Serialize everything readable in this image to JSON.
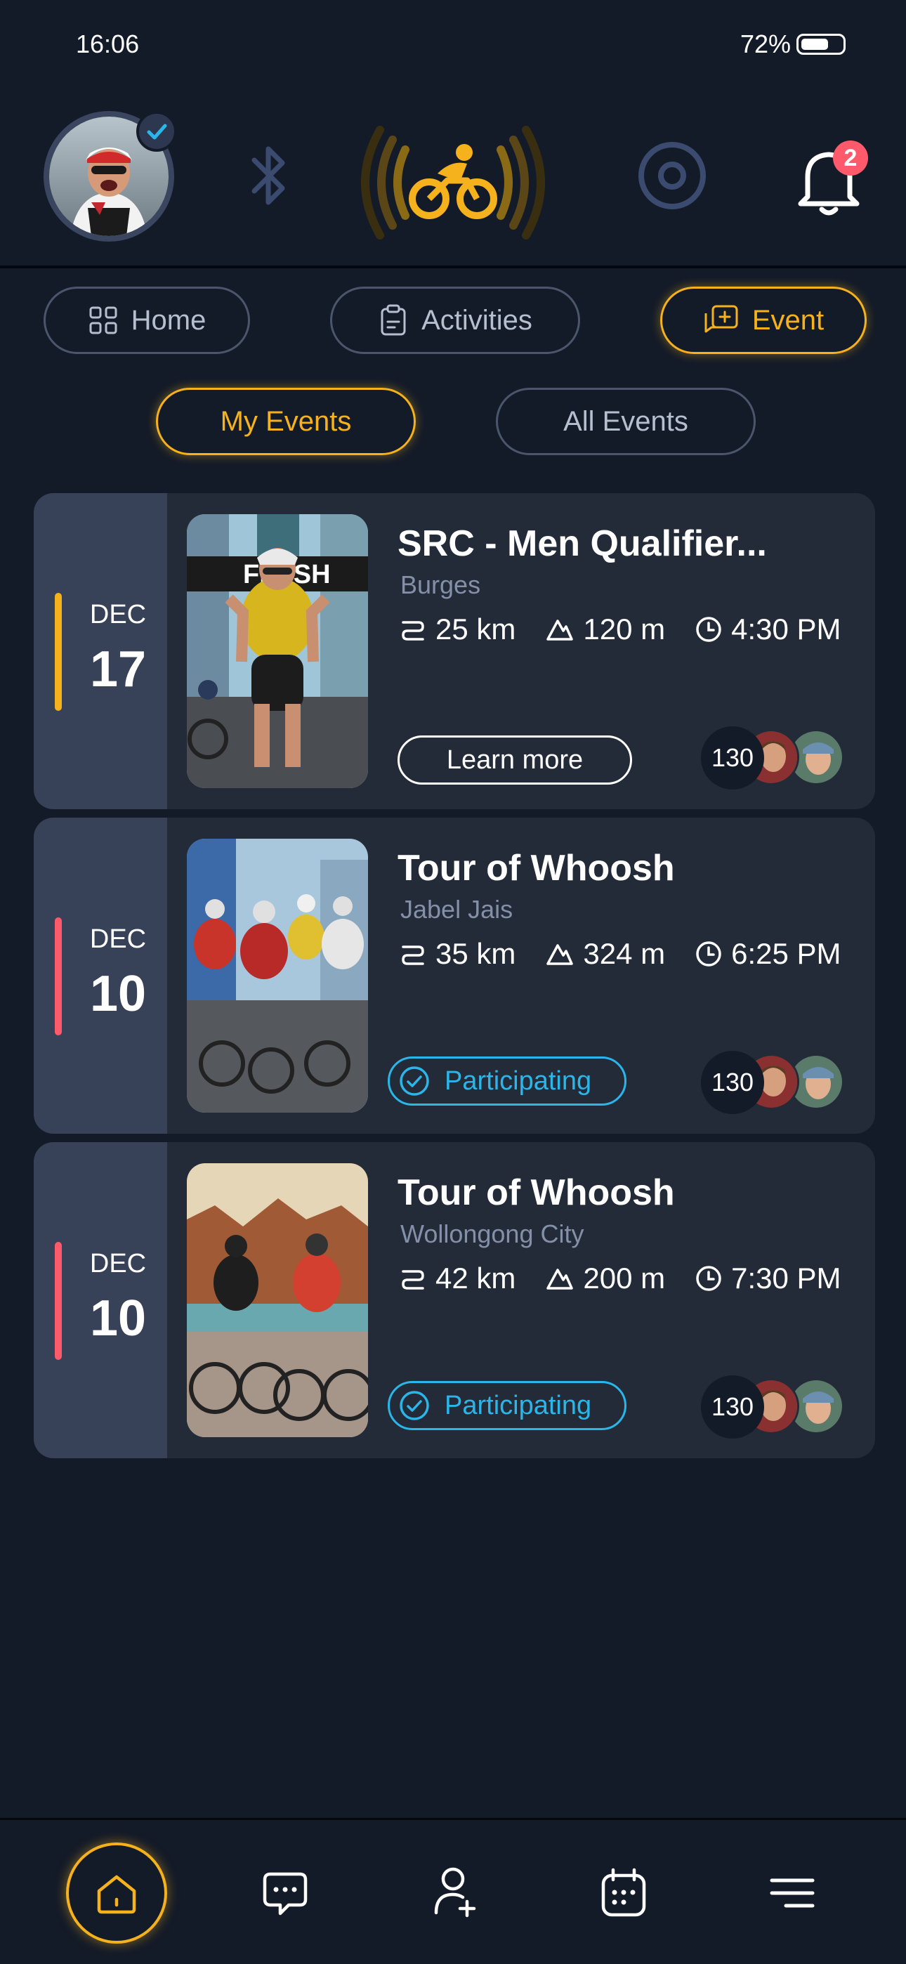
{
  "status": {
    "time": "16:06",
    "battery": "72%",
    "battery_level": 0.72
  },
  "notifications": {
    "count": "2"
  },
  "tabs": {
    "home": "Home",
    "activities": "Activities",
    "event": "Event"
  },
  "sub_tabs": {
    "my_events": "My Events",
    "all_events": "All Events"
  },
  "events": [
    {
      "month": "DEC",
      "day": "17",
      "title": "SRC - Men Qualifier...",
      "location": "Burges",
      "distance": "25 km",
      "elevation": "120 m",
      "time": "4:30 PM",
      "action": "Learn more",
      "participants": "130",
      "accent": "#f5b21c"
    },
    {
      "month": "DEC",
      "day": "10",
      "title": "Tour of Whoosh",
      "location": "Jabel Jais",
      "distance": "35 km",
      "elevation": "324 m",
      "time": "6:25 PM",
      "action": "Participating",
      "participants": "130",
      "accent": "#ff5a6b"
    },
    {
      "month": "DEC",
      "day": "10",
      "title": "Tour of Whoosh",
      "location": "Wollongong City",
      "distance": "42 km",
      "elevation": "200 m",
      "time": "7:30 PM",
      "action": "Participating",
      "participants": "130",
      "accent": "#ff5a6b"
    }
  ],
  "colors": {
    "accent": "#f5b21c",
    "participating": "#2ab6e8",
    "alert": "#ff5a6b",
    "background": "#141b28"
  },
  "icons": {
    "bottom_nav": [
      "home-icon",
      "chat-icon",
      "add-friend-icon",
      "calendar-icon",
      "menu-icon"
    ],
    "top": [
      "bluetooth-icon",
      "bike-connection-icon",
      "power-ring-icon",
      "bell-icon"
    ],
    "stats": [
      "route-icon",
      "elevation-icon",
      "clock-icon"
    ]
  }
}
